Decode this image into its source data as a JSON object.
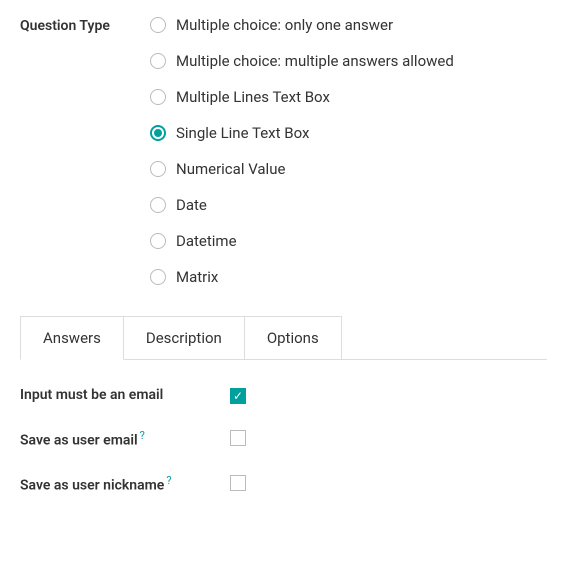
{
  "question_type": {
    "label": "Question Type",
    "options": [
      {
        "label": "Multiple choice: only one answer",
        "selected": false
      },
      {
        "label": "Multiple choice: multiple answers allowed",
        "selected": false
      },
      {
        "label": "Multiple Lines Text Box",
        "selected": false
      },
      {
        "label": "Single Line Text Box",
        "selected": true
      },
      {
        "label": "Numerical Value",
        "selected": false
      },
      {
        "label": "Date",
        "selected": false
      },
      {
        "label": "Datetime",
        "selected": false
      },
      {
        "label": "Matrix",
        "selected": false
      }
    ]
  },
  "tabs": [
    {
      "label": "Answers",
      "active": true
    },
    {
      "label": "Description",
      "active": false
    },
    {
      "label": "Options",
      "active": false
    }
  ],
  "answers_tab": {
    "input_email": {
      "label": "Input must be an email",
      "checked": true,
      "help": false
    },
    "save_email": {
      "label": "Save as user email",
      "checked": false,
      "help": true
    },
    "save_nickname": {
      "label": "Save as user nickname",
      "checked": false,
      "help": true
    }
  },
  "help_glyph": "?"
}
